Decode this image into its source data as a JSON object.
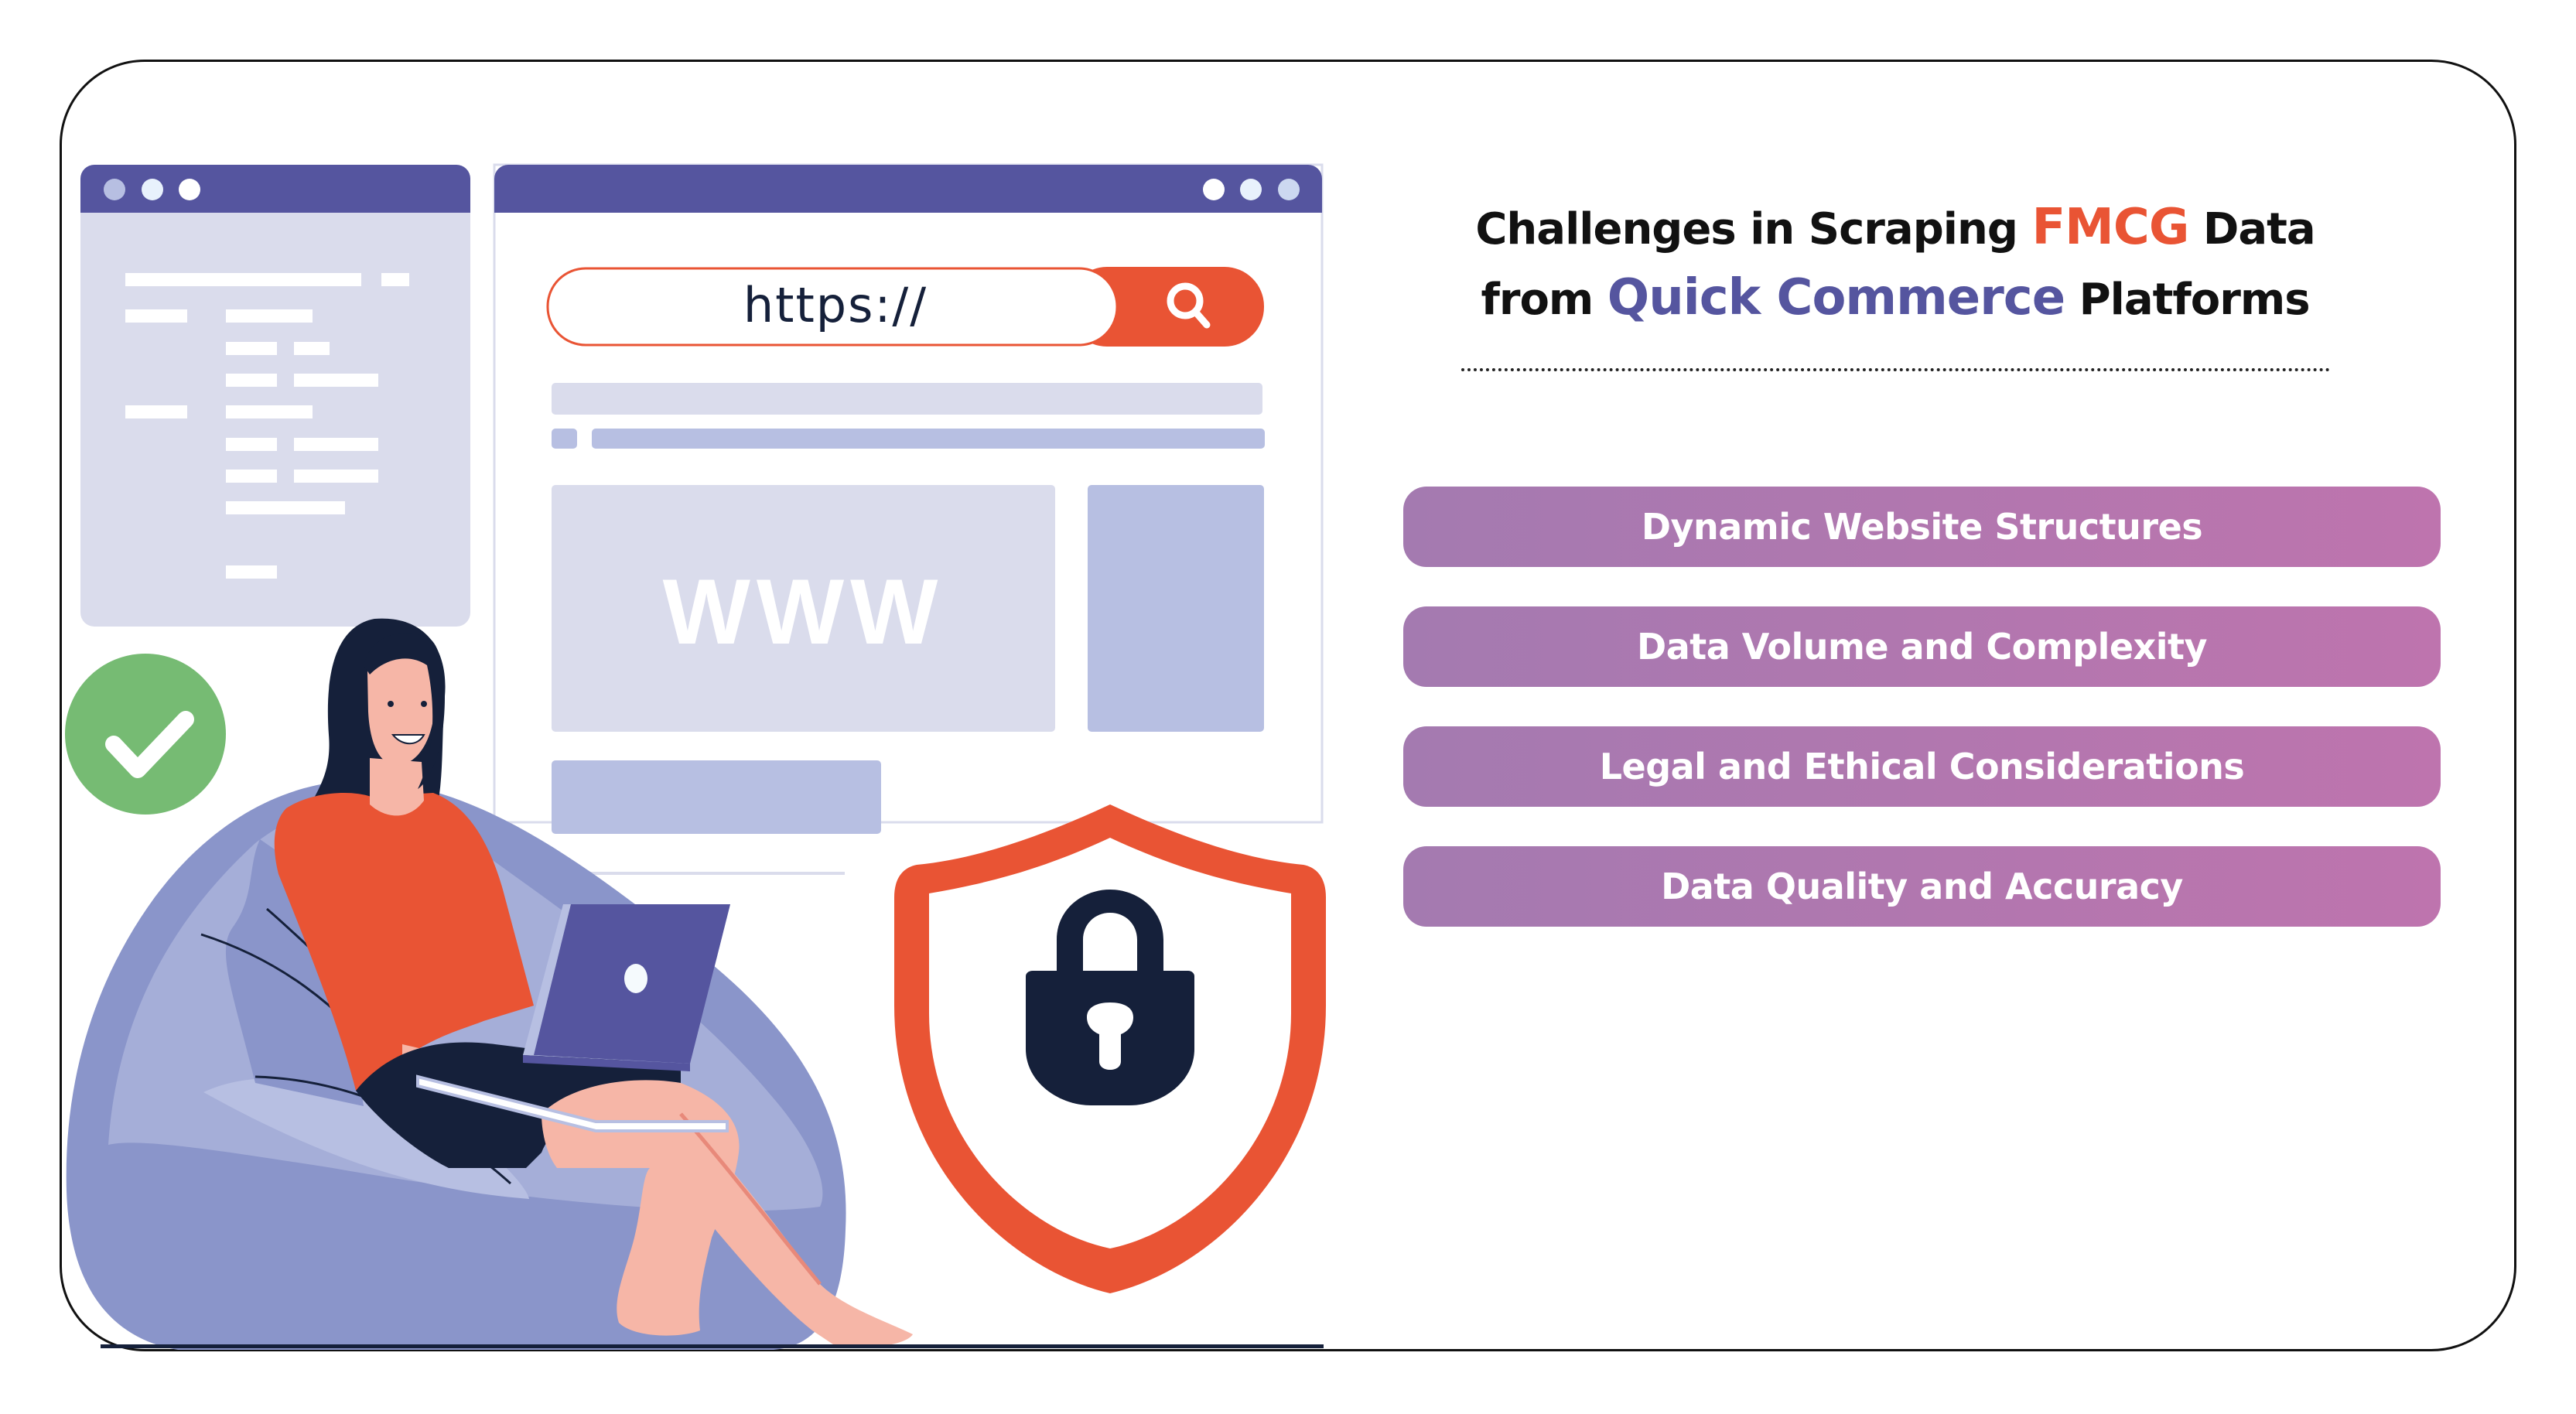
{
  "title": {
    "line1_prefix": "Challenges in Scraping",
    "line1_highlight": "FMCG",
    "line1_suffix": "Data",
    "line2_prefix": "from",
    "line2_highlight": "Quick Commerce",
    "line2_suffix": "Platforms"
  },
  "challenges": [
    {
      "label": "Dynamic Website Structures"
    },
    {
      "label": "Data Volume and Complexity"
    },
    {
      "label": "Legal and Ethical Considerations"
    },
    {
      "label": "Data Quality and Accuracy"
    }
  ],
  "illustration": {
    "browser_url": "https://",
    "web_placeholder": "WWW",
    "icons": [
      "search-icon",
      "check-circle-icon",
      "shield-lock-icon",
      "laptop-icon"
    ]
  },
  "colors": {
    "accent_orange": "#E95434",
    "accent_purple": "#55559F",
    "pill_gradient_start": "#A47AB0",
    "pill_gradient_end": "#BE74AE",
    "success_green": "#76BB73",
    "navy": "#15203A"
  }
}
